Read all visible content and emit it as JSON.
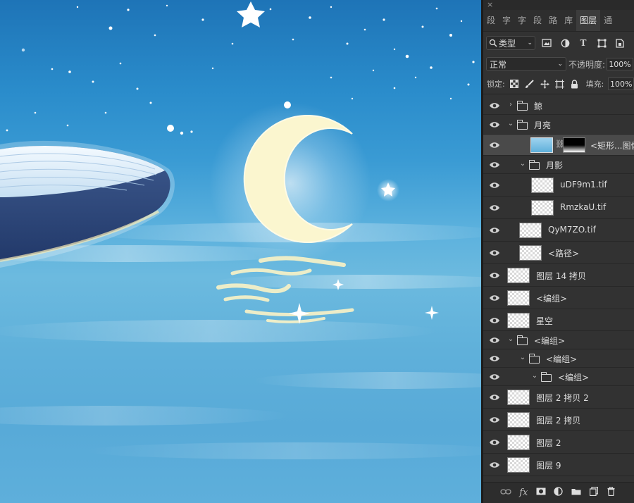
{
  "window": {
    "close_label": "×"
  },
  "tabs": [
    {
      "label": "段"
    },
    {
      "label": "字"
    },
    {
      "label": "字"
    },
    {
      "label": "段"
    },
    {
      "label": "路"
    },
    {
      "label": "库"
    },
    {
      "label": "图层"
    },
    {
      "label": "通"
    }
  ],
  "filter": {
    "type_label": "类型",
    "icons": [
      "image-filter-icon",
      "adjustment-filter-icon",
      "type-filter-icon",
      "shape-filter-icon",
      "smart-object-filter-icon"
    ]
  },
  "blend": {
    "mode": "正常",
    "opacity_label": "不透明度:",
    "opacity_value": "100%"
  },
  "lock": {
    "label": "锁定:",
    "fill_label": "填充:",
    "fill_value": "100%"
  },
  "layers": [
    {
      "name": "鲸",
      "kind": "group",
      "expanded": false,
      "indent": 0
    },
    {
      "name": "月亮",
      "kind": "group",
      "expanded": true,
      "indent": 0
    },
    {
      "name": "<矩形...图像",
      "kind": "masked",
      "indent": 1,
      "selected": true
    },
    {
      "name": "月影",
      "kind": "group",
      "expanded": true,
      "indent": 1
    },
    {
      "name": "uDF9m1.tif",
      "kind": "layer",
      "indent": 2
    },
    {
      "name": "RmzkaU.tif",
      "kind": "layer",
      "indent": 2
    },
    {
      "name": "QyM7ZO.tif",
      "kind": "layer",
      "indent": 1
    },
    {
      "name": "<路径>",
      "kind": "layer",
      "indent": 1
    },
    {
      "name": "图层 14 拷贝",
      "kind": "layer",
      "indent": 0
    },
    {
      "name": "<编组>",
      "kind": "layer",
      "indent": 0
    },
    {
      "name": "星空",
      "kind": "layer",
      "indent": 0
    },
    {
      "name": "<编组>",
      "kind": "group",
      "expanded": true,
      "indent": 0
    },
    {
      "name": "<编组>",
      "kind": "group",
      "expanded": true,
      "indent": 1
    },
    {
      "name": "<编组>",
      "kind": "group",
      "expanded": true,
      "indent": 2
    },
    {
      "name": "图层 2 拷贝 2",
      "kind": "layer",
      "indent": 0,
      "thumb": "sky"
    },
    {
      "name": "图层 2 拷贝",
      "kind": "layer",
      "indent": 0,
      "thumb": "sky"
    },
    {
      "name": "图层 2",
      "kind": "layer",
      "indent": 0,
      "thumb": "sky"
    },
    {
      "name": "图层 9",
      "kind": "layer",
      "indent": 0
    }
  ],
  "bottom_icons": [
    "link-icon",
    "fx-icon",
    "mask-icon",
    "adjustment-icon",
    "folder-icon",
    "new-layer-icon",
    "trash-icon"
  ],
  "bottom_labels": {
    "fx": "fx"
  }
}
